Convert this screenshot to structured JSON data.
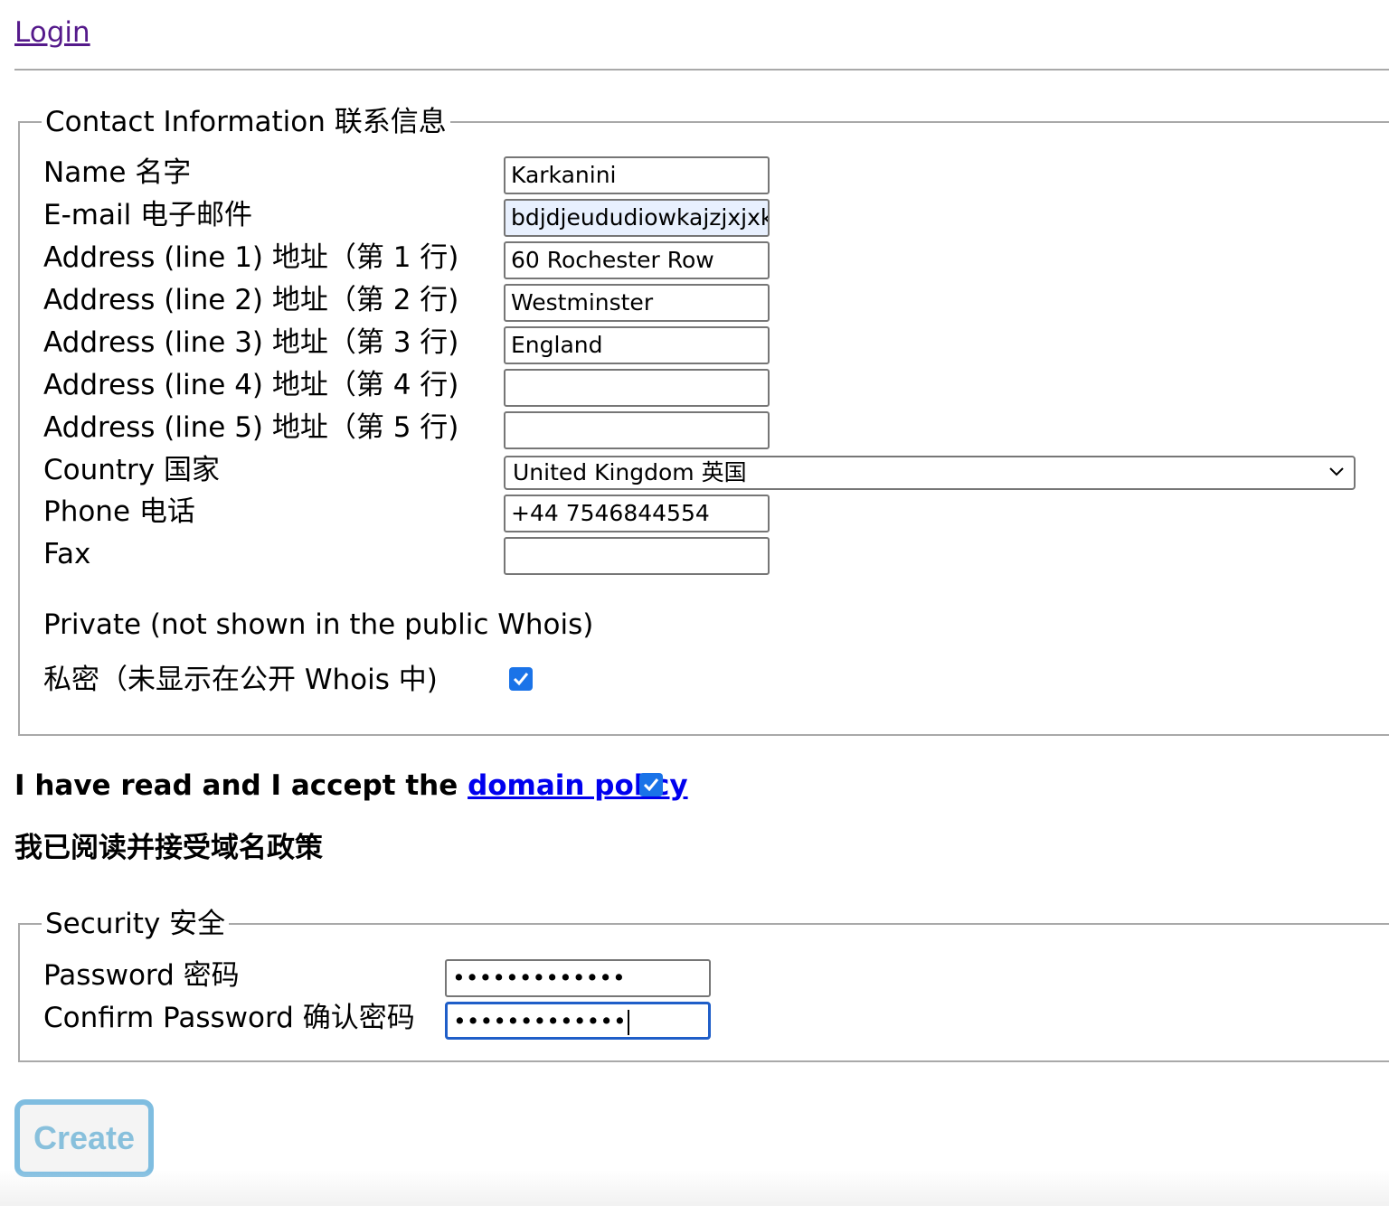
{
  "login_link": "Login",
  "contact": {
    "legend": "Contact Information 联系信息",
    "fields": {
      "name_label": "Name 名字",
      "name_value": "Karkanini",
      "email_label": "E-mail 电子邮件",
      "email_value": "bdjdjeududiowkajzjxjxk@",
      "addr1_label": "Address (line 1) 地址（第 1 行)",
      "addr1_value": "60 Rochester Row",
      "addr2_label": "Address (line 2) 地址（第 2 行)",
      "addr2_value": "Westminster",
      "addr3_label": "Address (line 3) 地址（第 3 行)",
      "addr3_value": "England",
      "addr4_label": "Address (line 4) 地址（第 4 行)",
      "addr4_value": "",
      "addr5_label": "Address (line 5) 地址（第 5 行)",
      "addr5_value": "",
      "country_label": "Country 国家",
      "country_value": "United Kingdom 英国",
      "phone_label": "Phone 电话",
      "phone_value": "+44 7546844554",
      "fax_label": "Fax",
      "fax_value": ""
    },
    "private_label_en": "Private (not shown in the public Whois)",
    "private_label_zh": "私密（未显示在公开 Whois 中)",
    "private_checked": true
  },
  "policy": {
    "text_before": "I have read and I accept the ",
    "link_text": "domain policy",
    "text_zh": "我已阅读并接受域名政策",
    "checked": true
  },
  "security": {
    "legend": "Security 安全",
    "password_label": "Password 密码",
    "password_value": "•••••••••••••",
    "confirm_label": "Confirm Password 确认密码",
    "confirm_value": "•••••••••••••"
  },
  "create_button": "Create",
  "colors": {
    "checkbox": "#1a73e8",
    "link_visited": "#551a8b",
    "link": "#0000ee",
    "focus_border": "#1f5ec8",
    "autofill_bg": "#e8f0fe",
    "create_border": "#7fbde0"
  }
}
